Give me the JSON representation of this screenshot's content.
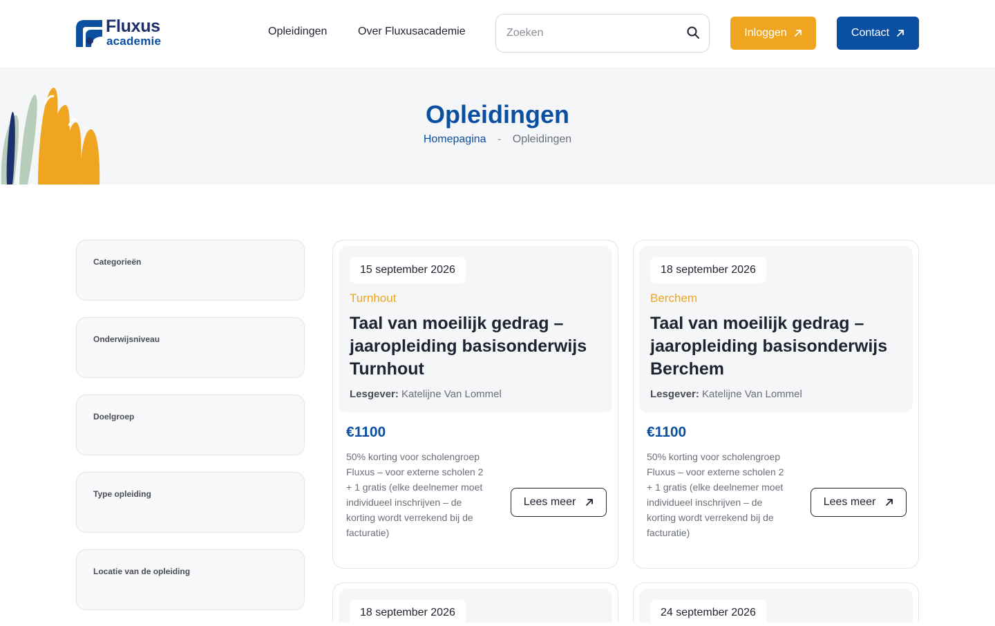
{
  "header": {
    "logo_line1": "Fluxus",
    "logo_line2": "academie",
    "nav": [
      "Opleidingen",
      "Over Fluxusacademie"
    ],
    "search_placeholder": "Zoeken",
    "login_label": "Inloggen",
    "contact_label": "Contact"
  },
  "hero": {
    "title": "Opleidingen",
    "breadcrumb": {
      "home": "Homepagina",
      "separator": "-",
      "current": "Opleidingen"
    }
  },
  "filters": [
    "Categorieën",
    "Onderwijsniveau",
    "Doelgroep",
    "Type opleiding",
    "Locatie van de opleiding"
  ],
  "cards": [
    {
      "date": "15 september 2026",
      "location": "Turnhout",
      "title": "Taal van moeilijk gedrag – jaaropleiding basisonderwijs Turnhout",
      "teacher_label": "Lesgever:",
      "teacher": "Katelijne Van Lommel",
      "price": "€1100",
      "note": "50% korting voor scholengroep Fluxus – voor externe scholen 2 + 1 gratis (elke deelnemer moet individueel inschrijven – de korting wordt verrekend bij de facturatie)",
      "button": "Lees meer"
    },
    {
      "date": "18 september 2026",
      "location": "Berchem",
      "title": "Taal van moeilijk gedrag – jaaropleiding basisonderwijs Berchem",
      "teacher_label": "Lesgever:",
      "teacher": "Katelijne Van Lommel",
      "price": "€1100",
      "note": "50% korting voor scholengroep Fluxus – voor externe scholen 2 + 1 gratis (elke deelnemer moet individueel inschrijven – de korting wordt verrekend bij de facturatie)",
      "button": "Lees meer"
    },
    {
      "date": "18 september 2026"
    },
    {
      "date": "24 september 2026"
    }
  ],
  "colors": {
    "brand_blue": "#0b4fa0",
    "brand_orange": "#efa51f",
    "navy": "#1e2f6e"
  },
  "icons": {
    "search": "search-icon",
    "arrow": "arrow-up-right-icon"
  }
}
